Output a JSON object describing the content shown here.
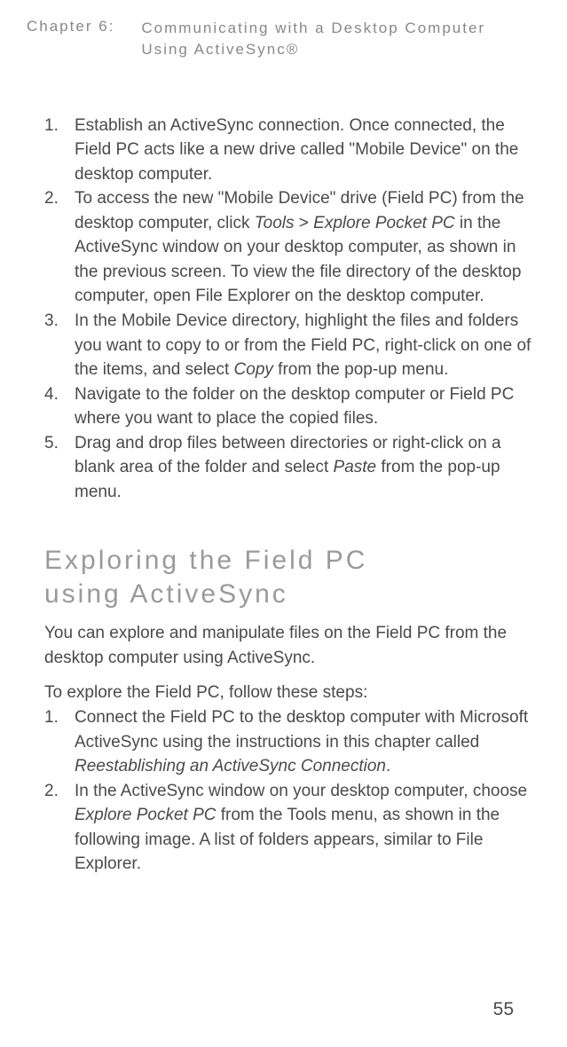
{
  "header": {
    "chapter_label": "Chapter 6:",
    "chapter_title_line1": "Communicating with a Desktop Computer",
    "chapter_title_line2": "Using ActiveSync®"
  },
  "list1": {
    "items": [
      {
        "num": "1.",
        "parts": [
          {
            "t": "Establish an ActiveSync connection. Once connected, the Field PC acts like a new drive called \"Mobile Device\" on the desktop computer.",
            "i": false
          }
        ]
      },
      {
        "num": "2.",
        "parts": [
          {
            "t": "To access the new \"Mobile Device\" drive (Field PC) from the desktop computer, click ",
            "i": false
          },
          {
            "t": "Tools",
            "i": true
          },
          {
            "t": " > ",
            "i": false
          },
          {
            "t": "Explore Pocket PC",
            "i": true
          },
          {
            "t": " in the ActiveSync window on your desktop computer, as shown in the previous screen. To view the file directory of the desktop computer, open File Explorer on the desktop computer.",
            "i": false
          }
        ]
      },
      {
        "num": "3.",
        "parts": [
          {
            "t": "In the Mobile Device directory, highlight the files and folders you want to copy to or from the Field PC, right-click on one of the items, and select ",
            "i": false
          },
          {
            "t": "Copy",
            "i": true
          },
          {
            "t": " from the pop-up menu.",
            "i": false
          }
        ]
      },
      {
        "num": "4.",
        "parts": [
          {
            "t": "Navigate to the folder on the desktop computer or Field PC where you want to place the copied files.",
            "i": false
          }
        ]
      },
      {
        "num": "5.",
        "parts": [
          {
            "t": "Drag and drop files between directories or right-click on a blank area of the folder and select ",
            "i": false
          },
          {
            "t": "Paste",
            "i": true
          },
          {
            "t": " from the pop-up menu.",
            "i": false
          }
        ]
      }
    ]
  },
  "section_heading_line1": "Exploring the Field PC",
  "section_heading_line2": "using ActiveSync",
  "para1": "You can explore and manipulate files on the Field PC from the desktop computer using ActiveSync.",
  "para2": "To explore the Field PC, follow these steps:",
  "list2": {
    "items": [
      {
        "num": "1.",
        "parts": [
          {
            "t": "Connect the Field PC to the desktop computer with Microsoft ActiveSync using the instructions in this chapter called ",
            "i": false
          },
          {
            "t": "Reestablishing an ActiveSync Connection",
            "i": true
          },
          {
            "t": ".",
            "i": false
          }
        ]
      },
      {
        "num": "2.",
        "parts": [
          {
            "t": "In the ActiveSync window on your desktop computer, choose ",
            "i": false
          },
          {
            "t": "Explore Pocket PC",
            "i": true
          },
          {
            "t": " from the Tools menu, as shown in the following image. A list of folders appears, similar to File Explorer.",
            "i": false
          }
        ]
      }
    ]
  },
  "page_number": "55"
}
